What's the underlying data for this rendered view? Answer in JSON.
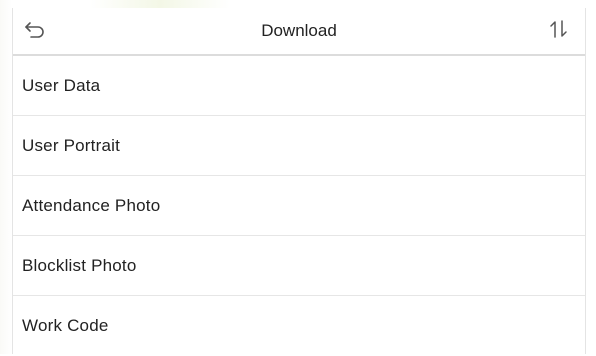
{
  "header": {
    "title": "Download",
    "back_icon": "back-arrow-icon",
    "sort_icon": "sort-icon"
  },
  "items": [
    {
      "label": "User Data"
    },
    {
      "label": "User Portrait"
    },
    {
      "label": "Attendance Photo"
    },
    {
      "label": "Blocklist Photo"
    },
    {
      "label": "Work Code"
    }
  ],
  "colors": {
    "text": "#222222",
    "divider": "#e6e6e6",
    "icon": "#555555"
  }
}
